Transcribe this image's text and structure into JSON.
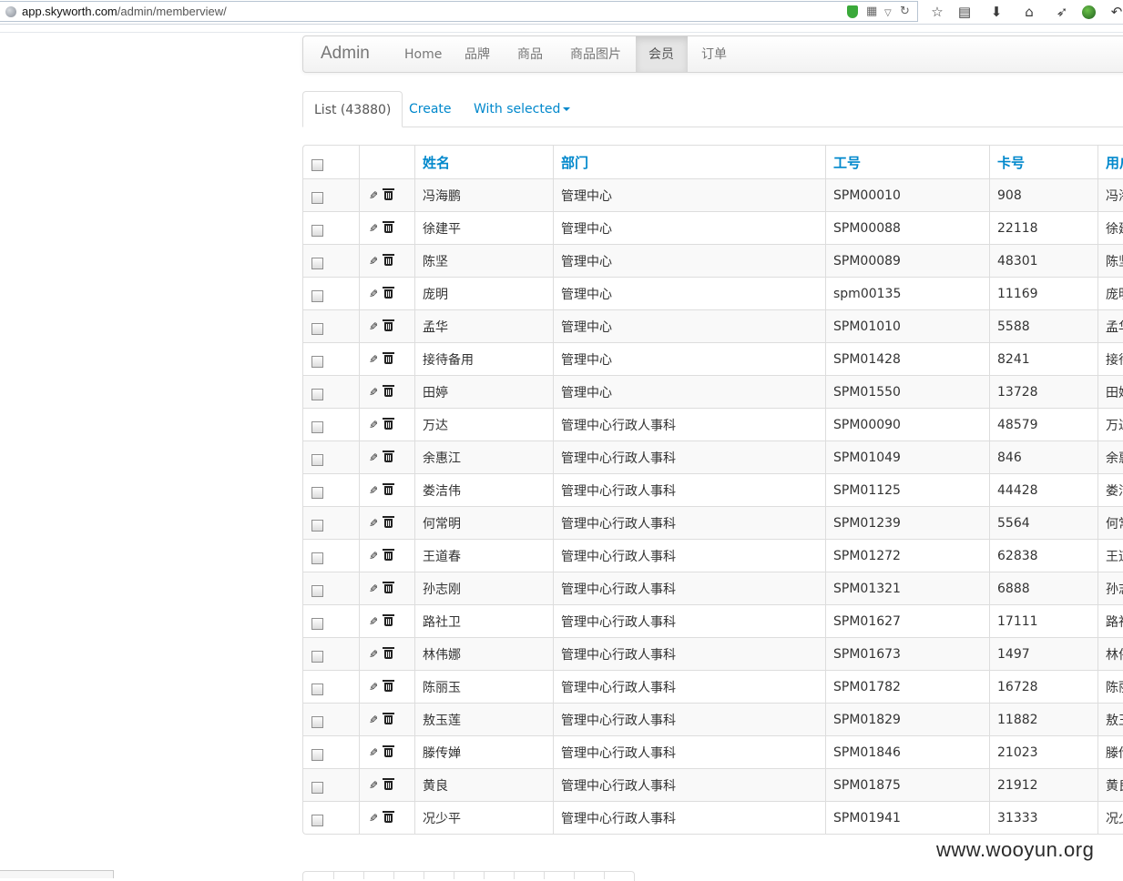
{
  "browser": {
    "url_host": "app.skyworth.com",
    "url_path": "/admin/memberview/"
  },
  "navbar": {
    "brand": "Admin",
    "items": [
      {
        "label": "Home",
        "active": false
      },
      {
        "label": "品牌",
        "active": false
      },
      {
        "label": "商品",
        "active": false
      },
      {
        "label": "商品图片",
        "active": false
      },
      {
        "label": "会员",
        "active": true
      },
      {
        "label": "订单",
        "active": false
      }
    ]
  },
  "tabs": {
    "list": "List (43880)",
    "create": "Create",
    "with_selected": "With selected"
  },
  "table": {
    "columns": [
      "姓名",
      "部门",
      "工号",
      "卡号",
      "用户名"
    ],
    "rows": [
      [
        "冯海鹏",
        "管理中心",
        "SPM00010",
        "908",
        "冯海鹏"
      ],
      [
        "徐建平",
        "管理中心",
        "SPM00088",
        "22118",
        "徐建平"
      ],
      [
        "陈坚",
        "管理中心",
        "SPM00089",
        "48301",
        "陈坚"
      ],
      [
        "庞明",
        "管理中心",
        "spm00135",
        "11169",
        "庞明"
      ],
      [
        "孟华",
        "管理中心",
        "SPM01010",
        "5588",
        "孟华"
      ],
      [
        "接待备用",
        "管理中心",
        "SPM01428",
        "8241",
        "接待备用"
      ],
      [
        "田婷",
        "管理中心",
        "SPM01550",
        "13728",
        "田婷"
      ],
      [
        "万达",
        "管理中心行政人事科",
        "SPM00090",
        "48579",
        "万达"
      ],
      [
        "余惠江",
        "管理中心行政人事科",
        "SPM01049",
        "846",
        "余惠江"
      ],
      [
        "娄洁伟",
        "管理中心行政人事科",
        "SPM01125",
        "44428",
        "娄洁伟"
      ],
      [
        "何常明",
        "管理中心行政人事科",
        "SPM01239",
        "5564",
        "何常明"
      ],
      [
        "王道春",
        "管理中心行政人事科",
        "SPM01272",
        "62838",
        "王道春"
      ],
      [
        "孙志刚",
        "管理中心行政人事科",
        "SPM01321",
        "6888",
        "孙志刚"
      ],
      [
        "路社卫",
        "管理中心行政人事科",
        "SPM01627",
        "17111",
        "路社卫"
      ],
      [
        "林伟娜",
        "管理中心行政人事科",
        "SPM01673",
        "1497",
        "林伟娜"
      ],
      [
        "陈丽玉",
        "管理中心行政人事科",
        "SPM01782",
        "16728",
        "陈丽玉"
      ],
      [
        "敖玉莲",
        "管理中心行政人事科",
        "SPM01829",
        "11882",
        "敖玉莲"
      ],
      [
        "滕传婵",
        "管理中心行政人事科",
        "SPM01846",
        "21023",
        "滕传婵"
      ],
      [
        "黄良",
        "管理中心行政人事科",
        "SPM01875",
        "21912",
        "黄良"
      ],
      [
        "况少平",
        "管理中心行政人事科",
        "SPM01941",
        "31333",
        "况少平"
      ]
    ]
  },
  "watermark": "www.wooyun.org",
  "colors": {
    "link": "#0088cc",
    "navbar_text": "#777777",
    "border": "#dddddd",
    "stripe": "#f9f9f9"
  }
}
